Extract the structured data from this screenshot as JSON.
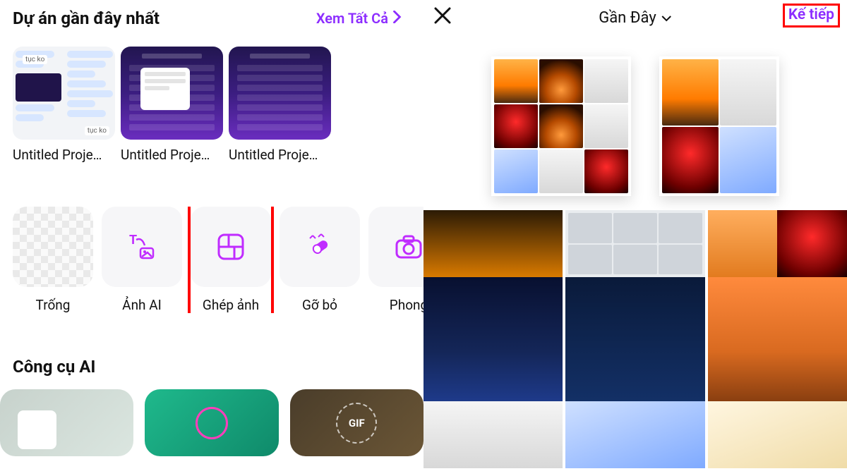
{
  "left": {
    "recent_title": "Dự án gần đây nhất",
    "view_all": "Xem Tất Cả",
    "projects": [
      {
        "name": "Untitled Proje…",
        "tag_a": "tục ko",
        "tag_b": "tục ko"
      },
      {
        "name": "Untitled Proje…"
      },
      {
        "name": "Untitled Proje…"
      }
    ],
    "tools": [
      {
        "id": "blank",
        "label": "Trống",
        "icon": "blank-icon"
      },
      {
        "id": "ai-image",
        "label": "Ảnh AI",
        "icon": "ai-text-to-image-icon"
      },
      {
        "id": "collage",
        "label": "Ghép ảnh",
        "icon": "collage-icon",
        "highlight": true
      },
      {
        "id": "remove",
        "label": "Gỡ bỏ",
        "icon": "eraser-icon"
      },
      {
        "id": "style",
        "label": "Phong",
        "icon": "camera-icon"
      }
    ],
    "ai_section_title": "Công cụ AI",
    "ai_cards": [
      {
        "id": "card-1"
      },
      {
        "id": "card-2"
      },
      {
        "id": "card-gif",
        "badge": "GIF"
      }
    ]
  },
  "right": {
    "close": "×",
    "album_label": "Gần Đây",
    "next_label": "Kế tiếp"
  }
}
